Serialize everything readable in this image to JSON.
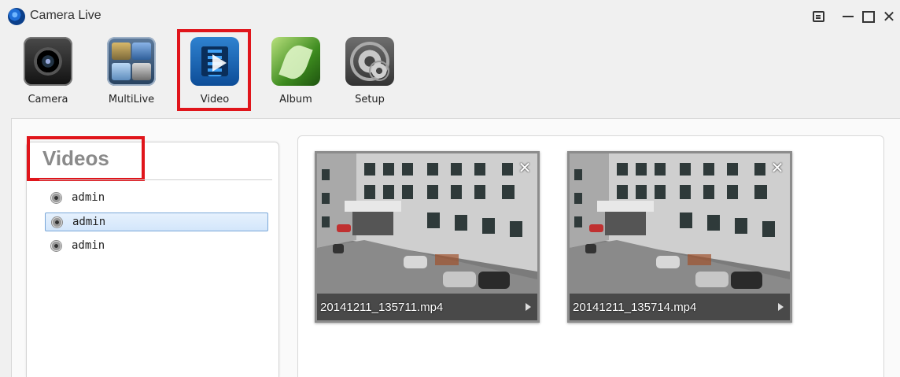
{
  "window": {
    "title": "Camera Live",
    "controls": {
      "menu": "menu-icon",
      "minimize": "minimize-icon",
      "maximize": "maximize-icon",
      "close": "close-icon"
    },
    "close_glyph": "✕"
  },
  "toolbar": {
    "items": [
      {
        "label": "Camera",
        "icon": "camera-icon"
      },
      {
        "label": "MultiLive",
        "icon": "multilive-icon"
      },
      {
        "label": "Video",
        "icon": "video-icon",
        "active": true
      },
      {
        "label": "Album",
        "icon": "album-icon"
      },
      {
        "label": "Setup",
        "icon": "setup-icon"
      }
    ]
  },
  "videos_panel": {
    "title": "Videos",
    "users": [
      {
        "label": "admin",
        "selected": false
      },
      {
        "label": "admin",
        "selected": true
      },
      {
        "label": "admin",
        "selected": false
      }
    ]
  },
  "thumbnails": [
    {
      "filename": "20141211_135711.mp4",
      "close": "✕"
    },
    {
      "filename": "20141211_135714.mp4",
      "close": "✕"
    }
  ],
  "colors": {
    "highlight": "#e0151b",
    "selection": "#d3e6fb"
  }
}
